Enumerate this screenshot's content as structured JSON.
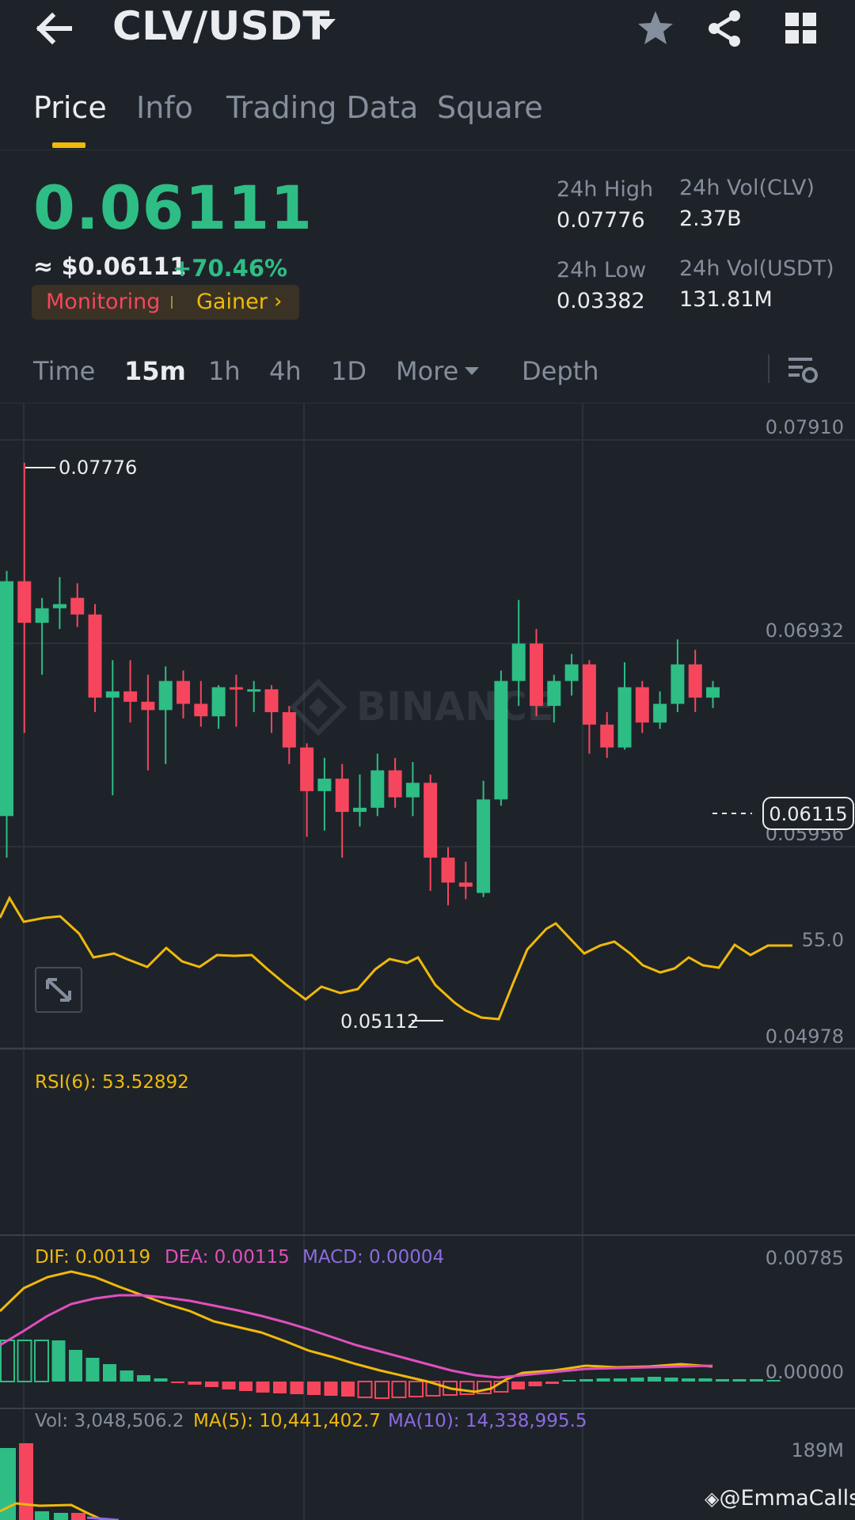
{
  "header": {
    "pair": "CLV/USDT"
  },
  "tabs": [
    "Price",
    "Info",
    "Trading Data",
    "Square"
  ],
  "price": {
    "last": "0.06111",
    "usd": "≈ $0.06111",
    "change": "+70.46%"
  },
  "tags": {
    "monitoring": "Monitoring",
    "gainer": "Gainer"
  },
  "stats": {
    "high_label": "24h High",
    "high_value": "0.07776",
    "low_label": "24h Low",
    "low_value": "0.03382",
    "vol_base_label": "24h Vol(CLV)",
    "vol_base_value": "2.37B",
    "vol_quote_label": "24h Vol(USDT)",
    "vol_quote_value": "131.81M"
  },
  "intervals": {
    "time": "Time",
    "m15": "15m",
    "h1": "1h",
    "h4": "4h",
    "d1": "1D",
    "more": "More",
    "depth": "Depth"
  },
  "chart": {
    "watermark": "BINANCE",
    "price_axis": [
      "0.07910",
      "0.06932",
      "0.05956",
      "0.04978"
    ],
    "high_marker": "0.07776",
    "low_marker": "0.05112",
    "current_price_tag": "0.06115",
    "rsi_label": "RSI(6): 53.52892",
    "rsi_axis": "55.0",
    "macd_dif": "DIF: 0.00119",
    "macd_dea": "DEA: 0.00115",
    "macd_val": "MACD: 0.00004",
    "macd_axis_top": "0.00785",
    "macd_axis_zero": "0.00000",
    "vol_label": "Vol: 3,048,506.2",
    "vol_ma5": "MA(5): 10,441,402.7",
    "vol_ma10": "MA(10): 14,338,995.5",
    "vol_axis": "189M"
  },
  "credit": "@EmmaCalls",
  "colors": {
    "up": "#2ebd85",
    "down": "#f6465d",
    "accent": "#f0b90b",
    "dea": "#e04fbf",
    "macd": "#8c6be0"
  },
  "candles": [
    {
      "o": 0.061,
      "h": 0.0728,
      "l": 0.059,
      "c": 0.0723,
      "up": true
    },
    {
      "o": 0.0723,
      "h": 0.078,
      "l": 0.065,
      "c": 0.0703,
      "up": false
    },
    {
      "o": 0.0703,
      "h": 0.0715,
      "l": 0.0678,
      "c": 0.071,
      "up": true
    },
    {
      "o": 0.071,
      "h": 0.0725,
      "l": 0.07,
      "c": 0.0712,
      "up": true
    },
    {
      "o": 0.0715,
      "h": 0.0722,
      "l": 0.0701,
      "c": 0.0707,
      "up": false
    },
    {
      "o": 0.0707,
      "h": 0.0712,
      "l": 0.066,
      "c": 0.0667,
      "up": false
    },
    {
      "o": 0.0667,
      "h": 0.0685,
      "l": 0.062,
      "c": 0.067,
      "up": true
    },
    {
      "o": 0.067,
      "h": 0.0685,
      "l": 0.0655,
      "c": 0.0665,
      "up": false
    },
    {
      "o": 0.0665,
      "h": 0.0678,
      "l": 0.0632,
      "c": 0.0661,
      "up": false
    },
    {
      "o": 0.0661,
      "h": 0.0682,
      "l": 0.0635,
      "c": 0.0675,
      "up": true
    },
    {
      "o": 0.0675,
      "h": 0.068,
      "l": 0.0657,
      "c": 0.0664,
      "up": false
    },
    {
      "o": 0.0664,
      "h": 0.0675,
      "l": 0.0653,
      "c": 0.0658,
      "up": false
    },
    {
      "o": 0.0658,
      "h": 0.0673,
      "l": 0.0652,
      "c": 0.0672,
      "up": true
    },
    {
      "o": 0.0672,
      "h": 0.0678,
      "l": 0.0653,
      "c": 0.0671,
      "up": false
    },
    {
      "o": 0.0671,
      "h": 0.0675,
      "l": 0.066,
      "c": 0.0671,
      "up": true
    },
    {
      "o": 0.0671,
      "h": 0.0673,
      "l": 0.065,
      "c": 0.066,
      "up": false
    },
    {
      "o": 0.066,
      "h": 0.0663,
      "l": 0.0635,
      "c": 0.0643,
      "up": false
    },
    {
      "o": 0.0643,
      "h": 0.0645,
      "l": 0.06,
      "c": 0.0622,
      "up": false
    },
    {
      "o": 0.0628,
      "h": 0.0638,
      "l": 0.0603,
      "c": 0.0622,
      "up": true
    },
    {
      "o": 0.0628,
      "h": 0.0635,
      "l": 0.059,
      "c": 0.0612,
      "up": false
    },
    {
      "o": 0.0612,
      "h": 0.063,
      "l": 0.0605,
      "c": 0.0614,
      "up": true
    },
    {
      "o": 0.0614,
      "h": 0.064,
      "l": 0.061,
      "c": 0.0632,
      "up": true
    },
    {
      "o": 0.0632,
      "h": 0.0638,
      "l": 0.0614,
      "c": 0.0619,
      "up": false
    },
    {
      "o": 0.0619,
      "h": 0.0636,
      "l": 0.061,
      "c": 0.0626,
      "up": true
    },
    {
      "o": 0.0626,
      "h": 0.063,
      "l": 0.0574,
      "c": 0.059,
      "up": false
    },
    {
      "o": 0.059,
      "h": 0.0595,
      "l": 0.0567,
      "c": 0.0578,
      "up": false
    },
    {
      "o": 0.0578,
      "h": 0.0588,
      "l": 0.057,
      "c": 0.0576,
      "up": false
    },
    {
      "o": 0.0573,
      "h": 0.0627,
      "l": 0.0571,
      "c": 0.0618,
      "up": true
    },
    {
      "o": 0.0618,
      "h": 0.068,
      "l": 0.0615,
      "c": 0.0675,
      "up": true
    },
    {
      "o": 0.0675,
      "h": 0.0714,
      "l": 0.0663,
      "c": 0.0693,
      "up": true
    },
    {
      "o": 0.0693,
      "h": 0.07,
      "l": 0.0658,
      "c": 0.0663,
      "up": false
    },
    {
      "o": 0.0663,
      "h": 0.0678,
      "l": 0.0655,
      "c": 0.0675,
      "up": true
    },
    {
      "o": 0.0675,
      "h": 0.0688,
      "l": 0.0668,
      "c": 0.0683,
      "up": true
    },
    {
      "o": 0.0683,
      "h": 0.0685,
      "l": 0.064,
      "c": 0.0654,
      "up": false
    },
    {
      "o": 0.0654,
      "h": 0.066,
      "l": 0.0638,
      "c": 0.0643,
      "up": false
    },
    {
      "o": 0.0643,
      "h": 0.0684,
      "l": 0.0642,
      "c": 0.0672,
      "up": true
    },
    {
      "o": 0.0672,
      "h": 0.0675,
      "l": 0.065,
      "c": 0.0655,
      "up": false
    },
    {
      "o": 0.0655,
      "h": 0.067,
      "l": 0.0652,
      "c": 0.0664,
      "up": true
    },
    {
      "o": 0.0664,
      "h": 0.0695,
      "l": 0.066,
      "c": 0.0683,
      "up": true
    },
    {
      "o": 0.0683,
      "h": 0.069,
      "l": 0.066,
      "c": 0.0667,
      "up": false
    },
    {
      "o": 0.0667,
      "h": 0.0675,
      "l": 0.0662,
      "c": 0.0672,
      "up": true
    }
  ]
}
